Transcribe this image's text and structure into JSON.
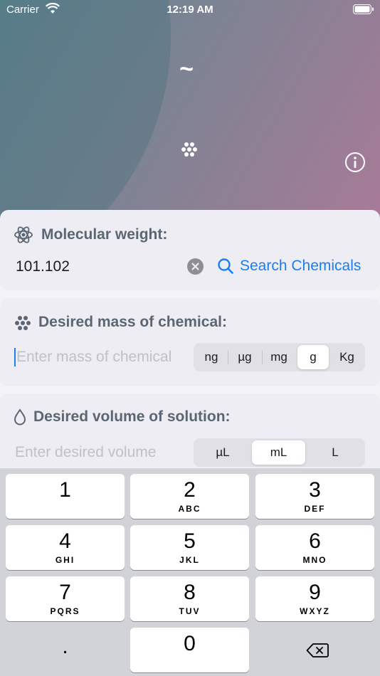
{
  "status_bar": {
    "carrier": "Carrier",
    "time": "12:19 AM"
  },
  "hero": {
    "tilde": "~"
  },
  "molecular_weight": {
    "title": "Molecular weight:",
    "value": "101.102",
    "search_label": "Search Chemicals"
  },
  "mass": {
    "title": "Desired mass of chemical:",
    "placeholder": "Enter mass of chemical",
    "units": [
      "ng",
      "µg",
      "mg",
      "g",
      "Kg"
    ],
    "selected_unit": "g"
  },
  "volume": {
    "title": "Desired volume of solution:",
    "placeholder": "Enter desired volume",
    "units": [
      "µL",
      "mL",
      "L"
    ],
    "selected_unit": "mL"
  },
  "keyboard": {
    "keys": [
      {
        "digit": "1",
        "letters": ""
      },
      {
        "digit": "2",
        "letters": "ABC"
      },
      {
        "digit": "3",
        "letters": "DEF"
      },
      {
        "digit": "4",
        "letters": "GHI"
      },
      {
        "digit": "5",
        "letters": "JKL"
      },
      {
        "digit": "6",
        "letters": "MNO"
      },
      {
        "digit": "7",
        "letters": "PQRS"
      },
      {
        "digit": "8",
        "letters": "TUV"
      },
      {
        "digit": "9",
        "letters": "WXYZ"
      },
      {
        "digit": "0",
        "letters": ""
      }
    ],
    "decimal": ".",
    "delete_icon": "delete-left-icon"
  },
  "colors": {
    "accent": "#1a7ef2",
    "card": "#ededf3",
    "title": "#5b6672"
  }
}
